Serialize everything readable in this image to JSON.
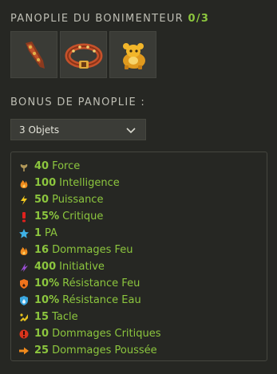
{
  "set": {
    "title": "PANOPLIE DU BONIMENTEUR",
    "count": "0/3",
    "items": [
      {
        "icon": "dagger-item-icon"
      },
      {
        "icon": "belt-item-icon"
      },
      {
        "icon": "pet-item-icon"
      }
    ]
  },
  "bonus": {
    "label": "BONUS DE PANOPLIE :",
    "selected": "3 Objets"
  },
  "stats": [
    {
      "value": "40",
      "label": "Force",
      "icon": "force-icon",
      "color": "#b49a5a"
    },
    {
      "value": "100",
      "label": "Intelligence",
      "icon": "flame-icon",
      "color": "#f08a1c"
    },
    {
      "value": "50",
      "label": "Puissance",
      "icon": "lightning-icon",
      "color": "#f2c91e"
    },
    {
      "value": "15%",
      "label": "Critique",
      "icon": "exclamation-icon",
      "color": "#e0211d"
    },
    {
      "value": "1",
      "label": "PA",
      "icon": "star-icon",
      "color": "#3fb2e6"
    },
    {
      "value": "16",
      "label": "Dommages Feu",
      "icon": "flame-icon",
      "color": "#f08a1c"
    },
    {
      "value": "400",
      "label": "Initiative",
      "icon": "initiative-icon",
      "color": "#9b4fd6"
    },
    {
      "value": "10%",
      "label": "Résistance Feu",
      "icon": "fire-shield-icon",
      "color": "#f0731c"
    },
    {
      "value": "10%",
      "label": "Résistance Eau",
      "icon": "water-shield-icon",
      "color": "#3aa7e0"
    },
    {
      "value": "15",
      "label": "Tacle",
      "icon": "tackle-icon",
      "color": "#e6c21e"
    },
    {
      "value": "10",
      "label": "Dommages Critiques",
      "icon": "critical-damage-icon",
      "color": "#d9351d"
    },
    {
      "value": "25",
      "label": "Dommages Poussée",
      "icon": "push-arrow-icon",
      "color": "#f08a1c"
    }
  ]
}
